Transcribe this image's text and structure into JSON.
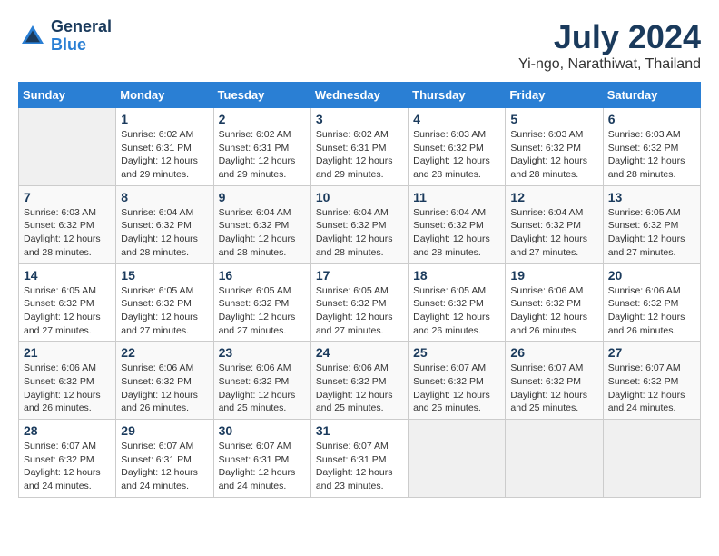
{
  "header": {
    "logo_line1": "General",
    "logo_line2": "Blue",
    "month": "July 2024",
    "location": "Yi-ngo, Narathiwat, Thailand"
  },
  "weekdays": [
    "Sunday",
    "Monday",
    "Tuesday",
    "Wednesday",
    "Thursday",
    "Friday",
    "Saturday"
  ],
  "weeks": [
    [
      {
        "day": "",
        "sunrise": "",
        "sunset": "",
        "daylight": ""
      },
      {
        "day": "1",
        "sunrise": "Sunrise: 6:02 AM",
        "sunset": "Sunset: 6:31 PM",
        "daylight": "Daylight: 12 hours and 29 minutes."
      },
      {
        "day": "2",
        "sunrise": "Sunrise: 6:02 AM",
        "sunset": "Sunset: 6:31 PM",
        "daylight": "Daylight: 12 hours and 29 minutes."
      },
      {
        "day": "3",
        "sunrise": "Sunrise: 6:02 AM",
        "sunset": "Sunset: 6:31 PM",
        "daylight": "Daylight: 12 hours and 29 minutes."
      },
      {
        "day": "4",
        "sunrise": "Sunrise: 6:03 AM",
        "sunset": "Sunset: 6:32 PM",
        "daylight": "Daylight: 12 hours and 28 minutes."
      },
      {
        "day": "5",
        "sunrise": "Sunrise: 6:03 AM",
        "sunset": "Sunset: 6:32 PM",
        "daylight": "Daylight: 12 hours and 28 minutes."
      },
      {
        "day": "6",
        "sunrise": "Sunrise: 6:03 AM",
        "sunset": "Sunset: 6:32 PM",
        "daylight": "Daylight: 12 hours and 28 minutes."
      }
    ],
    [
      {
        "day": "7",
        "sunrise": "Sunrise: 6:03 AM",
        "sunset": "Sunset: 6:32 PM",
        "daylight": "Daylight: 12 hours and 28 minutes."
      },
      {
        "day": "8",
        "sunrise": "Sunrise: 6:04 AM",
        "sunset": "Sunset: 6:32 PM",
        "daylight": "Daylight: 12 hours and 28 minutes."
      },
      {
        "day": "9",
        "sunrise": "Sunrise: 6:04 AM",
        "sunset": "Sunset: 6:32 PM",
        "daylight": "Daylight: 12 hours and 28 minutes."
      },
      {
        "day": "10",
        "sunrise": "Sunrise: 6:04 AM",
        "sunset": "Sunset: 6:32 PM",
        "daylight": "Daylight: 12 hours and 28 minutes."
      },
      {
        "day": "11",
        "sunrise": "Sunrise: 6:04 AM",
        "sunset": "Sunset: 6:32 PM",
        "daylight": "Daylight: 12 hours and 28 minutes."
      },
      {
        "day": "12",
        "sunrise": "Sunrise: 6:04 AM",
        "sunset": "Sunset: 6:32 PM",
        "daylight": "Daylight: 12 hours and 27 minutes."
      },
      {
        "day": "13",
        "sunrise": "Sunrise: 6:05 AM",
        "sunset": "Sunset: 6:32 PM",
        "daylight": "Daylight: 12 hours and 27 minutes."
      }
    ],
    [
      {
        "day": "14",
        "sunrise": "Sunrise: 6:05 AM",
        "sunset": "Sunset: 6:32 PM",
        "daylight": "Daylight: 12 hours and 27 minutes."
      },
      {
        "day": "15",
        "sunrise": "Sunrise: 6:05 AM",
        "sunset": "Sunset: 6:32 PM",
        "daylight": "Daylight: 12 hours and 27 minutes."
      },
      {
        "day": "16",
        "sunrise": "Sunrise: 6:05 AM",
        "sunset": "Sunset: 6:32 PM",
        "daylight": "Daylight: 12 hours and 27 minutes."
      },
      {
        "day": "17",
        "sunrise": "Sunrise: 6:05 AM",
        "sunset": "Sunset: 6:32 PM",
        "daylight": "Daylight: 12 hours and 27 minutes."
      },
      {
        "day": "18",
        "sunrise": "Sunrise: 6:05 AM",
        "sunset": "Sunset: 6:32 PM",
        "daylight": "Daylight: 12 hours and 26 minutes."
      },
      {
        "day": "19",
        "sunrise": "Sunrise: 6:06 AM",
        "sunset": "Sunset: 6:32 PM",
        "daylight": "Daylight: 12 hours and 26 minutes."
      },
      {
        "day": "20",
        "sunrise": "Sunrise: 6:06 AM",
        "sunset": "Sunset: 6:32 PM",
        "daylight": "Daylight: 12 hours and 26 minutes."
      }
    ],
    [
      {
        "day": "21",
        "sunrise": "Sunrise: 6:06 AM",
        "sunset": "Sunset: 6:32 PM",
        "daylight": "Daylight: 12 hours and 26 minutes."
      },
      {
        "day": "22",
        "sunrise": "Sunrise: 6:06 AM",
        "sunset": "Sunset: 6:32 PM",
        "daylight": "Daylight: 12 hours and 26 minutes."
      },
      {
        "day": "23",
        "sunrise": "Sunrise: 6:06 AM",
        "sunset": "Sunset: 6:32 PM",
        "daylight": "Daylight: 12 hours and 25 minutes."
      },
      {
        "day": "24",
        "sunrise": "Sunrise: 6:06 AM",
        "sunset": "Sunset: 6:32 PM",
        "daylight": "Daylight: 12 hours and 25 minutes."
      },
      {
        "day": "25",
        "sunrise": "Sunrise: 6:07 AM",
        "sunset": "Sunset: 6:32 PM",
        "daylight": "Daylight: 12 hours and 25 minutes."
      },
      {
        "day": "26",
        "sunrise": "Sunrise: 6:07 AM",
        "sunset": "Sunset: 6:32 PM",
        "daylight": "Daylight: 12 hours and 25 minutes."
      },
      {
        "day": "27",
        "sunrise": "Sunrise: 6:07 AM",
        "sunset": "Sunset: 6:32 PM",
        "daylight": "Daylight: 12 hours and 24 minutes."
      }
    ],
    [
      {
        "day": "28",
        "sunrise": "Sunrise: 6:07 AM",
        "sunset": "Sunset: 6:32 PM",
        "daylight": "Daylight: 12 hours and 24 minutes."
      },
      {
        "day": "29",
        "sunrise": "Sunrise: 6:07 AM",
        "sunset": "Sunset: 6:31 PM",
        "daylight": "Daylight: 12 hours and 24 minutes."
      },
      {
        "day": "30",
        "sunrise": "Sunrise: 6:07 AM",
        "sunset": "Sunset: 6:31 PM",
        "daylight": "Daylight: 12 hours and 24 minutes."
      },
      {
        "day": "31",
        "sunrise": "Sunrise: 6:07 AM",
        "sunset": "Sunset: 6:31 PM",
        "daylight": "Daylight: 12 hours and 23 minutes."
      },
      {
        "day": "",
        "sunrise": "",
        "sunset": "",
        "daylight": ""
      },
      {
        "day": "",
        "sunrise": "",
        "sunset": "",
        "daylight": ""
      },
      {
        "day": "",
        "sunrise": "",
        "sunset": "",
        "daylight": ""
      }
    ]
  ]
}
